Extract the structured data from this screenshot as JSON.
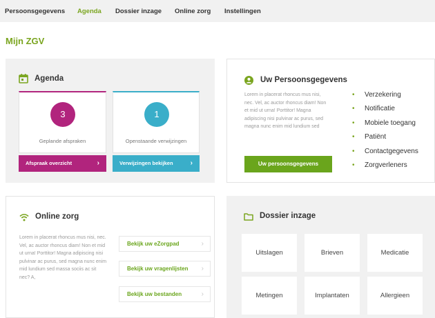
{
  "nav": {
    "items": [
      "Persoonsgegevens",
      "Agenda",
      "Dossier inzage",
      "Online zorg",
      "Instellingen"
    ],
    "active": "Agenda"
  },
  "page_title": "Mijn ZGV",
  "colors": {
    "brand_green": "#7aa51f",
    "button_green": "#6aa51c",
    "magenta": "#b1247d",
    "teal": "#3aaec9",
    "panel_grey": "#f1f1f1"
  },
  "agenda": {
    "title": "Agenda",
    "icon": "calendar-icon",
    "planned": {
      "count": "3",
      "label": "Geplande afspraken",
      "button": "Afspraak overzicht"
    },
    "referrals": {
      "count": "1",
      "label": "Openstaande verwijzingen",
      "button": "Verwijzingen bekijken"
    }
  },
  "persoonsgegevens": {
    "title": "Uw Persoonsgegevens",
    "icon": "user-icon",
    "text": "Lorem in placerat rhoncus mus nisi, nec. Vel, ac auctor rhoncus diam! Non et mid ut urna! Porttitor! Magna adipiscing nisi pulvinar ac purus, sed magna nunc enim mid lundium sed",
    "button": "Uw persoonsgegevens",
    "items": [
      "Verzekering",
      "Notificatie",
      "Mobiele toegang",
      "Patiënt",
      "Contactgegevens",
      "Zorgverleners"
    ]
  },
  "online_zorg": {
    "title": "Online zorg",
    "icon": "wifi-icon",
    "text": "Lorem in placerat rhoncus mus nisi, nec. Vel, ac auctor rhoncus diam! Non et mid ut urna! Porttitor! Magna adipiscing nisi pulvinar ac purus, sed magna nunc enim mid lundium sed massa sociis ac sit nec? A,",
    "buttons": [
      "Bekijk uw eZorgpad",
      "Bekijk uw vragenlijsten",
      "Bekijk uw bestanden"
    ]
  },
  "dossier": {
    "title": "Dossier inzage",
    "icon": "folder-icon",
    "tiles": [
      "Uitslagen",
      "Brieven",
      "Medicatie",
      "Metingen",
      "Implantaten",
      "Allergieen"
    ]
  }
}
